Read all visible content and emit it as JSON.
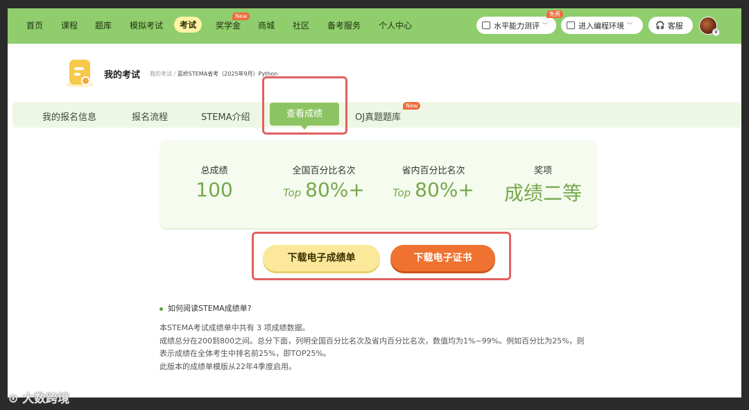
{
  "topnav": {
    "items": [
      "首页",
      "课程",
      "题库",
      "模拟考试",
      "考试",
      "奖学金",
      "商城",
      "社区",
      "备考服务",
      "个人中心"
    ],
    "active_index": 4,
    "new_badge": "New",
    "ability_test": "水平能力测评",
    "free_badge": "免费",
    "coding_env": "进入编程环境",
    "support": "客服"
  },
  "header": {
    "title": "我的考试",
    "breadcrumb_root": "我的考试 / ",
    "breadcrumb_current": "蓝桥STEMA省考（2025年9月）Python"
  },
  "subnav": {
    "items": [
      "我的报名信息",
      "报名流程",
      "STEMA介绍",
      "查看成绩",
      "OJ真题题库"
    ],
    "active_index": 3,
    "new_badge": "New"
  },
  "scores": {
    "total_label": "总成绩",
    "total_value": "100",
    "national_label": "全国百分比名次",
    "national_prefix": "Top",
    "national_value": "80%+",
    "province_label": "省内百分比名次",
    "province_prefix": "Top",
    "province_value": "80%+",
    "award_label": "奖项",
    "award_value": "成绩二等"
  },
  "buttons": {
    "download_report": "下载电子成绩单",
    "download_certificate": "下载电子证书"
  },
  "info": {
    "title": "如何阅读STEMA成绩单?",
    "line1": "本STEMA考试成绩单中共有 3 项成绩数据。",
    "line2": "成绩总分在200到800之间。总分下面，列明全国百分比名次及省内百分比名次，数值均为1%~99%。例如百分比为25%，则表示成绩在全体考生中排名前25%，即TOP25%。",
    "line3": "此版本的成绩单模版从22年4季度启用。"
  },
  "watermark": "大数跨境",
  "colors": {
    "nav_green": "#8fcd6d",
    "accent_green": "#76a84d",
    "tab_green": "#8dc463",
    "orange": "#ef7230",
    "yellow": "#fbe89a",
    "highlight_red": "#e26060"
  }
}
